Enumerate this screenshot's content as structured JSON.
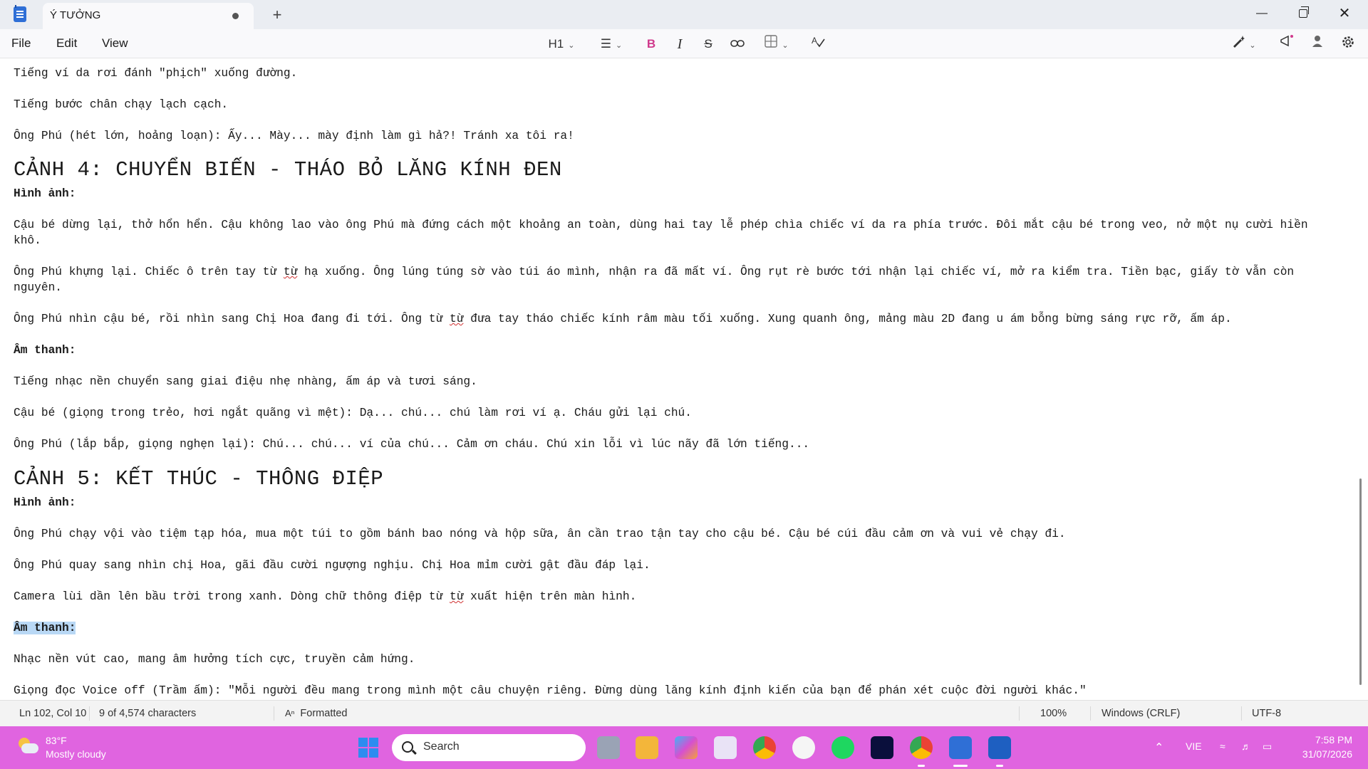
{
  "window": {
    "tab_title": "Ý TƯỞNG",
    "new_tab_glyph": "+",
    "minimize_glyph": "—",
    "close_glyph": "✕"
  },
  "menu": {
    "file": "File",
    "edit": "Edit",
    "view": "View"
  },
  "toolbar": {
    "heading": "H1",
    "bold": "B",
    "italic": "I",
    "strikethrough": "S"
  },
  "document": {
    "l1": "Tiếng ví da rơi đánh \"phịch\" xuống đường.",
    "l2": "Tiếng bước chân chạy lạch cạch.",
    "l3": "Ông Phú (hét lớn, hoảng loạn): Ấy... Mày... mày định làm gì hả?! Tránh xa tôi ra!",
    "h4": "CẢNH 4: CHUYỂN BIẾN - THÁO BỎ LĂNG KÍNH ĐEN",
    "img4": "Hình ảnh:",
    "p4a_1": "Cậu bé dừng lại, thở hổn hển. Cậu không lao vào ông Phú mà đứng cách một khoảng an toàn, dùng hai tay lễ phép chìa chiếc ví da ra phía trước. Đôi mắt cậu bé trong veo, nở một nụ cười hiền",
    "p4a_2": "khô.",
    "p4b_1_pre": "Ông Phú khựng lại. Chiếc ô trên tay từ ",
    "p4b_1_word": "từ",
    "p4b_1_post": " hạ xuống. Ông lúng túng sờ vào túi áo mình, nhận ra đã mất ví. Ông rụt rè bước tới nhận lại chiếc ví, mở ra kiểm tra. Tiền bạc, giấy tờ vẫn còn",
    "p4b_2": "nguyên.",
    "p4c_pre": "Ông Phú nhìn cậu bé, rồi nhìn sang Chị Hoa đang đi tới. Ông từ ",
    "p4c_word": "từ",
    "p4c_post": " đưa tay tháo chiếc kính râm màu tối xuống. Xung quanh ông, mảng màu 2D đang u ám bỗng bừng sáng rực rỡ, ấm áp.",
    "snd4": "Âm thanh:",
    "s4a": "Tiếng nhạc nền chuyển sang giai điệu nhẹ nhàng, ấm áp và tươi sáng.",
    "s4b": "Cậu bé (giọng trong trẻo, hơi ngắt quãng vì mệt): Dạ... chú... chú làm rơi ví ạ. Cháu gửi lại chú.",
    "s4c": "Ông Phú (lắp bắp, giọng nghẹn lại): Chú... chú... ví của chú... Cảm ơn cháu. Chú xin lỗi vì lúc nãy đã lớn tiếng...",
    "h5": "CẢNH 5: KẾT THÚC - THÔNG ĐIỆP",
    "img5": "Hình ảnh:",
    "p5a": "Ông Phú chạy vội vào tiệm tạp hóa, mua một túi to gồm bánh bao nóng và hộp sữa, ân cần trao tận tay cho cậu bé. Cậu bé cúi đầu cảm ơn và vui vẻ chạy đi.",
    "p5b": "Ông Phú quay sang nhìn chị Hoa, gãi đầu cười ngượng nghịu. Chị Hoa mỉm cười gật đầu đáp lại.",
    "p5c_pre": "Camera lùi dần lên bầu trời trong xanh. Dòng chữ thông điệp từ ",
    "p5c_word": "từ",
    "p5c_post": " xuất hiện trên màn hình.",
    "snd5": "Âm thanh:",
    "s5a": "Nhạc nền vút cao, mang âm hưởng tích cực, truyền cảm hứng.",
    "s5b": "Giọng đọc Voice off (Trầm ấm): \"Mỗi người đều mang trong mình một câu chuyện riêng. Đừng dùng lăng kính định kiến của bạn để phán xét cuộc đời người khác.\""
  },
  "statusbar": {
    "position": "Ln 102, Col 10",
    "characters": "9 of 4,574 characters",
    "format": "Formatted",
    "zoom": "100%",
    "line_ending": "Windows (CRLF)",
    "encoding": "UTF-8"
  },
  "taskbar": {
    "temperature": "83°F",
    "condition": "Mostly cloudy",
    "search_label": "Search",
    "language": "VIE",
    "time": "7:58 PM",
    "date": "31/07/2026"
  },
  "colors": {
    "taskbar": "#e064e0",
    "accent_bold": "#d03a8c",
    "selection": "#b9d8f5"
  }
}
